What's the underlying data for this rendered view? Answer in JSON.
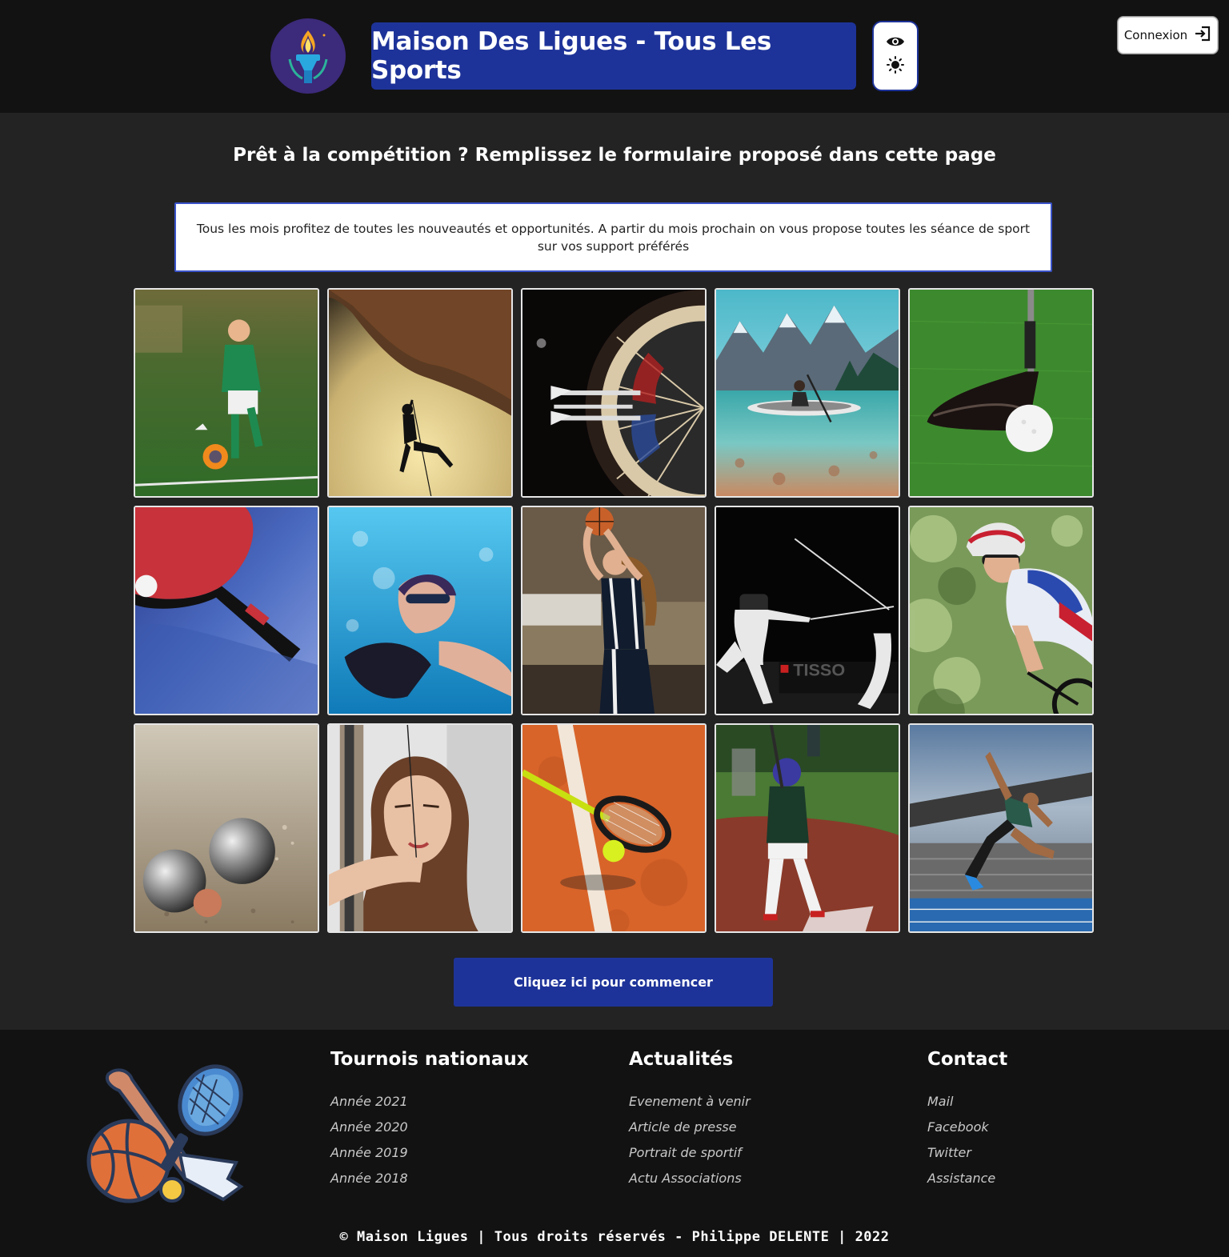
{
  "header": {
    "title": "Maison Des Ligues - Tous Les Sports",
    "login_label": "Connexion",
    "logo_icon": "torch-icon",
    "accessibility": {
      "view_icon": "eye-icon",
      "theme_icon": "sun-icon"
    }
  },
  "main": {
    "headline": "Prêt à la compétition ? Remplissez le formulaire proposé dans cette page",
    "intro": "Tous les mois profitez de toutes les nouveautés et opportunités. A partir du mois prochain on vous propose toutes les séance de sport sur vos support préférés",
    "cta_label": "Cliquez ici pour commencer",
    "sports": [
      {
        "name": "football"
      },
      {
        "name": "escalade"
      },
      {
        "name": "flechettes"
      },
      {
        "name": "kayak"
      },
      {
        "name": "golf"
      },
      {
        "name": "tennis-de-table"
      },
      {
        "name": "natation"
      },
      {
        "name": "basketball"
      },
      {
        "name": "escrime"
      },
      {
        "name": "cyclisme"
      },
      {
        "name": "petanque"
      },
      {
        "name": "tir-a-l-arc"
      },
      {
        "name": "tennis"
      },
      {
        "name": "baseball"
      },
      {
        "name": "athletisme"
      }
    ]
  },
  "footer": {
    "logo_icon": "sports-equipment-icon",
    "columns": [
      {
        "title": "Tournois nationaux",
        "links": [
          "Année 2021",
          "Année 2020",
          "Année 2019",
          "Année 2018"
        ]
      },
      {
        "title": "Actualités",
        "links": [
          "Evenement à venir",
          "Article de presse",
          "Portrait de sportif",
          "Actu Associations"
        ]
      },
      {
        "title": "Contact",
        "links": [
          "Mail",
          "Facebook",
          "Twitter",
          "Assistance"
        ]
      }
    ],
    "copyright": "© Maison Ligues | Tous droits réservés - Philippe DELENTE | 2022"
  },
  "colors": {
    "primary": "#1e3399",
    "background": "#232323",
    "header_bg": "#121212"
  }
}
